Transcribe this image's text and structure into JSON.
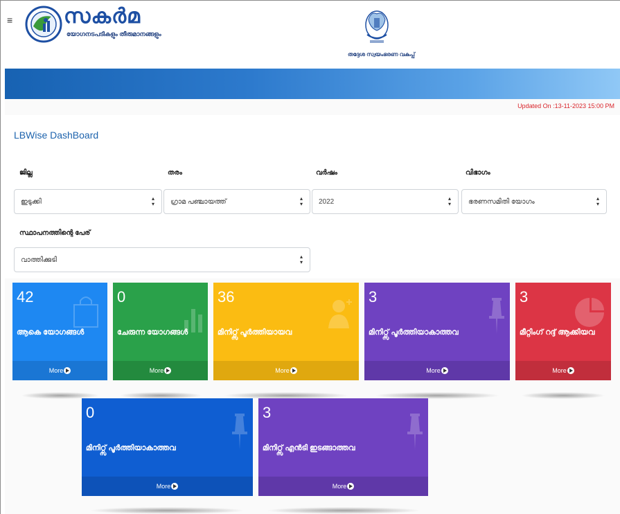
{
  "header": {
    "menu_icon": "hamburger-icon",
    "brand_title": "സകർമ",
    "brand_subtitle": "യോഗനടപടികളും തീരുമാനങ്ങളും",
    "dept_name": "തദ്ദേശ സ്വയംഭരണ വകുപ്പ്"
  },
  "updated_text": "Updated On :13-11-2023 15:00 PM",
  "page_title": "LBWise DashBoard",
  "filters": {
    "district_label": "ജില്ല",
    "district_value": "ഇടുക്കി",
    "type_label": "തരം",
    "type_value": "ഗ്രാമ പഞ്ചായത്ത്",
    "year_label": "വർഷം",
    "year_value": "2022",
    "category_label": "വിഭാഗം",
    "category_value": "ഭരണസമിതി യോഗം",
    "institution_label": "സ്ഥാപനത്തിന്റെ പേര്",
    "institution_value": "വാത്തിക്കുടി"
  },
  "tiles": [
    {
      "count": "42",
      "label": "ആകെ യോഗങ്ങൾ",
      "more": "More",
      "color": "#1e88f2",
      "footer": "#1a76d4",
      "icon": "bag-icon"
    },
    {
      "count": "0",
      "label": "ചേരുന്ന യോഗങ്ങൾ",
      "more": "More",
      "color": "#2aa14a",
      "footer": "#238a3e",
      "icon": "bar-chart-icon"
    },
    {
      "count": "36",
      "label": "മിനിറ്റ്സ് പൂർത്തിയായവ",
      "more": "More",
      "color": "#fbbc12",
      "footer": "#e0a80f",
      "icon": "user-add-icon"
    },
    {
      "count": "3",
      "label": "മിനിറ്റ്സ് പൂർത്തിയാകാത്തവ",
      "more": "More",
      "color": "#6f42c1",
      "footer": "#5f38a8",
      "icon": "pin-icon"
    },
    {
      "count": "3",
      "label": "മീറ്റിംഗ് റദ്ദ് ആക്കിയവ",
      "more": "More",
      "color": "#dc3545",
      "footer": "#c12e3c",
      "icon": "pie-chart-icon"
    },
    {
      "count": "0",
      "label": "മിനിറ്റ്സ് പൂർത്തിയാകാത്തവ",
      "more": "More",
      "color": "#0f5ed2",
      "footer": "#0d52b8",
      "icon": "pin-icon"
    },
    {
      "count": "3",
      "label": "മിനിറ്റ്സ് എൻടി ഇടങ്ങാത്തവ",
      "more": "More",
      "color": "#6f42c1",
      "footer": "#5f38a8",
      "icon": "pin-icon"
    }
  ]
}
